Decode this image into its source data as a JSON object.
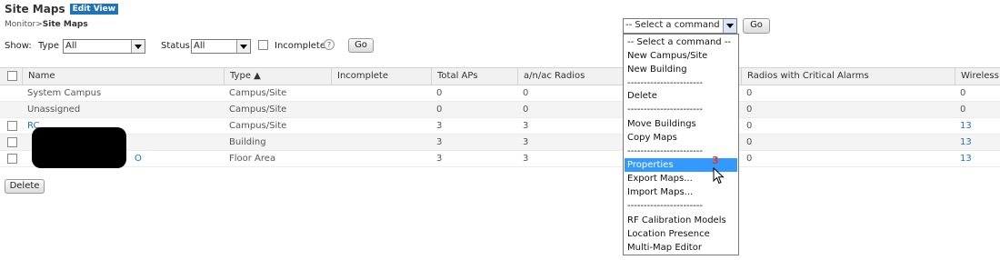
{
  "header": {
    "title": "Site Maps",
    "edit_view": "Edit View",
    "breadcrumb_parent": "Monitor",
    "breadcrumb_sep": ">",
    "breadcrumb_current": "Site Maps"
  },
  "filters": {
    "show_label": "Show:",
    "type_label": "Type",
    "type_value": "All",
    "status_label": "Status",
    "status_value": "All",
    "incomplete_label": "Incomplete",
    "go_label": "Go"
  },
  "command": {
    "selected": "-- Select a command --",
    "go_label": "Go",
    "options": [
      "-- Select a command --",
      "New Campus/Site",
      "New Building",
      "-----------------------",
      "Delete",
      "-----------------------",
      "Move Buildings",
      "Copy Maps",
      "-----------------------",
      "Properties",
      "Export Maps...",
      "Import Maps...",
      "-----------------------",
      "RF Calibration Models",
      "Location Presence",
      "Multi-Map Editor"
    ],
    "highlighted": "Properties",
    "annotation": "3"
  },
  "table": {
    "columns": [
      "Name",
      "Type",
      "Incomplete",
      "Total APs",
      "a/n/ac Radios",
      "Radios with Critical Alarms",
      "Wireless C"
    ],
    "sort_indicator": "▲",
    "rows": [
      {
        "name": "System Campus",
        "type": "Campus/Site",
        "incomplete": "",
        "total_aps": "0",
        "radios": "0",
        "critical": "0",
        "wireless": "0"
      },
      {
        "name": "Unassigned",
        "type": "Campus/Site",
        "incomplete": "",
        "total_aps": "0",
        "radios": "0",
        "critical": "0",
        "wireless": "0"
      },
      {
        "name": "RC",
        "type": "Campus/Site",
        "incomplete": "",
        "total_aps": "3",
        "radios": "3",
        "critical": "0",
        "wireless": "13"
      },
      {
        "name": "",
        "type": "Building",
        "incomplete": "",
        "total_aps": "3",
        "radios": "3",
        "critical": "0",
        "wireless": "13"
      },
      {
        "name": "O",
        "type": "Floor Area",
        "incomplete": "",
        "total_aps": "3",
        "radios": "3",
        "critical": "0",
        "wireless": "13"
      }
    ]
  },
  "footer": {
    "delete_label": "Delete"
  }
}
